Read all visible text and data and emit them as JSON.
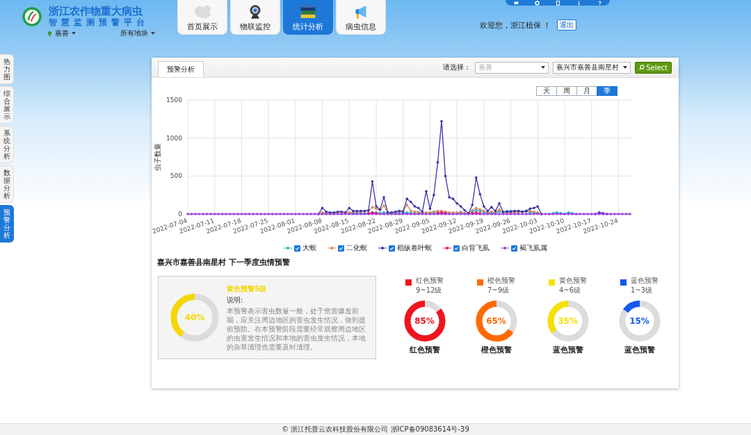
{
  "header": {
    "title_line1": "浙江农作物重大病虫",
    "title_line2": "智慧监测预警平台",
    "region": "嘉善",
    "plot": "所有地块",
    "nav": [
      {
        "label": "首页展示",
        "kind": "map",
        "selected": false
      },
      {
        "label": "物联监控",
        "kind": "camera",
        "selected": false
      },
      {
        "label": "统计分析",
        "kind": "books",
        "selected": true
      },
      {
        "label": "病虫信息",
        "kind": "megaphone",
        "selected": false
      }
    ],
    "toolbar": [
      {
        "kind": "chat"
      },
      {
        "kind": "gear"
      },
      {
        "kind": "doc"
      },
      {
        "kind": "info"
      },
      {
        "kind": "help"
      }
    ],
    "welcome": "欢迎您，浙江植保 ！",
    "logout": "退出"
  },
  "side_tabs": [
    {
      "label": "热力图",
      "selected": false
    },
    {
      "label": "综合展示",
      "selected": false
    },
    {
      "label": "系统分析",
      "selected": false
    },
    {
      "label": "数据分析",
      "selected": false
    },
    {
      "label": "预警分析",
      "selected": true
    }
  ],
  "panel": {
    "tab": "预警分析",
    "select_label": "请选择：",
    "select1": {
      "placeholder": "嘉善"
    },
    "select2": {
      "value": "嘉兴市嘉善县南星村"
    },
    "button": "Select",
    "periods": [
      {
        "label": "天",
        "selected": false
      },
      {
        "label": "周",
        "selected": false
      },
      {
        "label": "月",
        "selected": false
      },
      {
        "label": "季",
        "selected": true
      }
    ],
    "chart_data": {
      "type": "line",
      "grid": true,
      "ylabel": "虫子数量",
      "ylim": [
        0,
        1500
      ],
      "yticks": [
        0,
        500,
        1000,
        1500
      ],
      "categories": [
        "2022-07-04",
        null,
        null,
        null,
        null,
        null,
        null,
        "2022-07-11",
        null,
        null,
        null,
        null,
        null,
        null,
        "2022-07-18",
        null,
        null,
        null,
        null,
        null,
        null,
        "2022-07-25",
        null,
        null,
        null,
        null,
        null,
        null,
        "2022-08-01",
        null,
        null,
        null,
        null,
        null,
        null,
        "2022-08-08",
        null,
        null,
        null,
        null,
        null,
        null,
        "2022-08-15",
        null,
        null,
        null,
        null,
        null,
        null,
        "2022-08-22",
        null,
        null,
        null,
        null,
        null,
        null,
        "2022-08-29",
        null,
        null,
        null,
        null,
        null,
        null,
        "2022-09-05",
        null,
        null,
        null,
        null,
        null,
        null,
        "2022-09-12",
        null,
        null,
        null,
        null,
        null,
        null,
        "2022-09-19",
        null,
        null,
        null,
        null,
        null,
        null,
        "2022-09-26",
        null,
        null,
        null,
        null,
        null,
        null,
        "2022-10-03",
        null,
        null,
        null,
        null,
        null,
        null,
        "2022-10-10",
        null,
        null,
        null,
        null,
        null,
        null,
        "2022-10-17",
        null,
        null,
        null,
        null,
        null,
        null,
        "2022-10-24",
        null,
        null,
        null
      ],
      "series": [
        {
          "name": "大螟",
          "color": "#2bb0c8",
          "values": [
            null,
            null,
            null,
            null,
            null,
            null,
            null,
            null,
            null,
            null,
            null,
            null,
            null,
            null,
            null,
            null,
            null,
            null,
            null,
            null,
            null,
            null,
            null,
            null,
            null,
            null,
            null,
            null,
            null,
            null,
            null,
            null,
            null,
            null,
            null,
            null,
            null,
            null,
            null,
            null,
            null,
            null,
            10,
            10,
            10,
            10,
            10,
            10,
            20,
            20,
            10,
            20,
            10,
            10,
            10,
            10,
            10,
            20,
            10,
            10,
            10,
            10,
            null,
            10,
            20,
            20,
            20,
            10,
            10,
            null,
            10,
            10,
            10,
            0,
            30,
            50,
            40,
            20,
            10,
            10,
            10,
            30,
            20,
            40,
            40,
            40,
            30,
            30,
            30,
            20,
            20,
            10,
            0,
            null,
            0,
            10,
            20,
            10,
            0,
            20,
            10,
            0,
            null,
            null,
            null,
            null,
            null,
            null,
            null,
            null,
            null,
            null,
            null,
            null,
            null,
            null
          ]
        },
        {
          "name": "二化螟",
          "color": "#d08a5a",
          "values": [
            null,
            null,
            null,
            null,
            null,
            null,
            null,
            null,
            null,
            null,
            null,
            null,
            null,
            null,
            null,
            null,
            null,
            null,
            null,
            null,
            null,
            null,
            null,
            null,
            null,
            null,
            null,
            null,
            null,
            null,
            null,
            null,
            null,
            null,
            0,
            20,
            10,
            10,
            10,
            20,
            20,
            20,
            20,
            20,
            30,
            30,
            40,
            40,
            90,
            70,
            50,
            110,
            20,
            20,
            20,
            30,
            40,
            120,
            40,
            30,
            30,
            10,
            20,
            20,
            30,
            40,
            40,
            30,
            20,
            20,
            20,
            30,
            10,
            10,
            50,
            80,
            60,
            40,
            20,
            30,
            20,
            60,
            20,
            20,
            20,
            20,
            20,
            30,
            40,
            40,
            30,
            20,
            0,
            null,
            null,
            null,
            null,
            null,
            null,
            null,
            null,
            null,
            null,
            null,
            null,
            null,
            null,
            null,
            null,
            null,
            null,
            null,
            null,
            null,
            null,
            null
          ]
        },
        {
          "name": "稻纵卷叶螟",
          "color": "#3a35a8",
          "values": [
            null,
            null,
            null,
            null,
            null,
            null,
            null,
            null,
            null,
            null,
            null,
            null,
            null,
            null,
            null,
            null,
            null,
            null,
            null,
            null,
            null,
            null,
            null,
            null,
            null,
            null,
            null,
            null,
            null,
            null,
            null,
            null,
            null,
            null,
            0,
            80,
            30,
            20,
            20,
            30,
            30,
            20,
            80,
            40,
            40,
            40,
            40,
            50,
            430,
            100,
            60,
            220,
            20,
            20,
            30,
            40,
            30,
            200,
            160,
            100,
            80,
            30,
            300,
            70,
            250,
            680,
            1220,
            500,
            220,
            200,
            140,
            100,
            50,
            10,
            120,
            480,
            260,
            100,
            40,
            90,
            40,
            140,
            30,
            30,
            30,
            40,
            40,
            30,
            40,
            70,
            80,
            100,
            0,
            null,
            null,
            null,
            null,
            null,
            null,
            null,
            null,
            null,
            null,
            null,
            null,
            null,
            0,
            20,
            10,
            0,
            null,
            null,
            null,
            null,
            null,
            null
          ]
        },
        {
          "name": "白背飞虱",
          "color": "#e8157a",
          "values": [
            null,
            null,
            null,
            null,
            null,
            null,
            null,
            null,
            null,
            null,
            null,
            null,
            null,
            null,
            null,
            null,
            null,
            null,
            null,
            null,
            null,
            null,
            null,
            null,
            null,
            null,
            null,
            null,
            null,
            null,
            null,
            null,
            null,
            null,
            null,
            null,
            null,
            null,
            null,
            null,
            null,
            null,
            null,
            null,
            null,
            null,
            null,
            10,
            20,
            10,
            null,
            null,
            null,
            null,
            null,
            null,
            null,
            null,
            null,
            null,
            null,
            null,
            null,
            null,
            null,
            10,
            20,
            10,
            null,
            null,
            null,
            null,
            null,
            null,
            10,
            20,
            10,
            null,
            null,
            null,
            null,
            null,
            null,
            null,
            null,
            null,
            null,
            null,
            null,
            null,
            null,
            null,
            null,
            null,
            null,
            null,
            null,
            null,
            null,
            null,
            null,
            null,
            null,
            null,
            null,
            null,
            null,
            null,
            null,
            null,
            null,
            null,
            null,
            null,
            null,
            null
          ]
        },
        {
          "name": "褐飞虱属",
          "color": "#a040e0",
          "values": [
            0,
            0,
            0,
            0,
            0,
            0,
            0,
            0,
            0,
            0,
            0,
            0,
            0,
            0,
            0,
            0,
            0,
            0,
            0,
            0,
            0,
            0,
            0,
            0,
            0,
            0,
            0,
            0,
            0,
            0,
            0,
            0,
            0,
            0,
            0,
            0,
            0,
            0,
            0,
            0,
            0,
            0,
            0,
            0,
            0,
            0,
            0,
            0,
            0,
            0,
            0,
            0,
            0,
            0,
            0,
            0,
            0,
            0,
            0,
            0,
            0,
            0,
            0,
            0,
            0,
            0,
            0,
            0,
            0,
            0,
            0,
            0,
            0,
            0,
            0,
            0,
            0,
            0,
            0,
            0,
            0,
            0,
            0,
            0,
            0,
            0,
            0,
            0,
            0,
            0,
            0,
            0,
            0,
            0,
            0,
            0,
            0,
            0,
            0,
            0,
            0,
            0,
            0,
            0,
            0,
            0,
            0,
            0,
            0,
            0,
            0,
            0,
            0,
            0,
            0,
            0
          ]
        }
      ]
    },
    "legend": [
      {
        "checked": true
      },
      {
        "checked": true
      },
      {
        "checked": true
      },
      {
        "checked": true
      },
      {
        "checked": true
      }
    ],
    "warning": {
      "title": "嘉兴市嘉善县南星村 下一季度虫情预警",
      "current": {
        "percent": "40%",
        "level": 0.4,
        "color": "#f5d800",
        "heading": "黄色预警5级",
        "note_label": "说明:",
        "note": "本预警表示害虫数量一般，处于危害爆发前期，应关注周边地区的害虫发生情况，做到提前预防。在本预警阶段需要经常观察周边地区的虫害发生情况和本地的害虫发生情况，本地的杂草清理也需要及时清理。"
      },
      "levels": [
        {
          "name": "红色预警",
          "range": "9~12级",
          "color": "#f0141e",
          "percent": "85%",
          "level": 0.85,
          "caption": "红色预警"
        },
        {
          "name": "橙色预警",
          "range": "7~9级",
          "color": "#ff6a00",
          "percent": "65%",
          "level": 0.65,
          "caption": "橙色预警"
        },
        {
          "name": "黄色预警",
          "range": "4~6级",
          "color": "#f5e000",
          "percent": "35%",
          "level": 0.35,
          "caption": "蓝色预警"
        },
        {
          "name": "蓝色预警",
          "range": "1~3级",
          "color": "#1558f0",
          "percent": "15%",
          "level": 0.15,
          "caption": "蓝色预警"
        }
      ]
    }
  },
  "footer": "© 浙江托普云农科技股份有限公司 浙ICP备09083614号-39"
}
